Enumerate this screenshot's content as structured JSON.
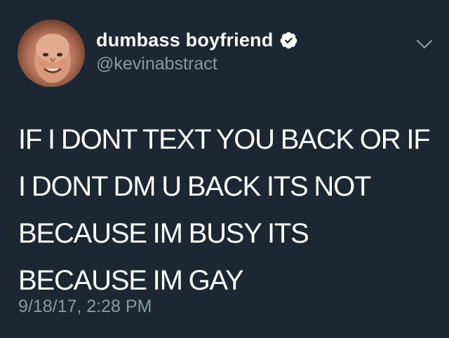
{
  "tweet": {
    "display_name": "dumbass boyfriend",
    "handle": "@kevinabstract",
    "verified": true,
    "text": "IF I DONT TEXT YOU BACK OR IF\nI DONT DM U BACK ITS NOT\nBECAUSE IM BUSY ITS\nBECAUSE IM GAY",
    "timestamp": "9/18/17, 2:28 PM"
  },
  "icons": {
    "verified": "verified-badge-icon",
    "menu": "chevron-down-icon",
    "avatar": "profile-photo"
  },
  "colors": {
    "background": "#1c2733",
    "primary_text": "#ffffff",
    "secondary_text": "#8899a6",
    "caret": "#8899a6"
  }
}
